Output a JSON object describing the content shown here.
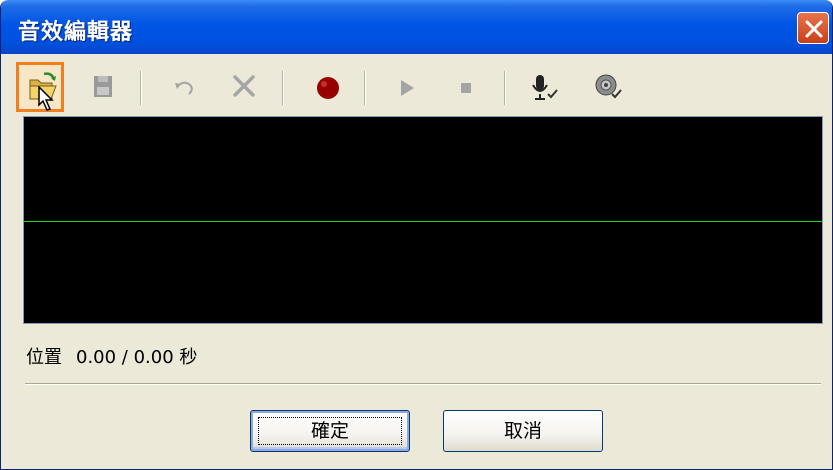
{
  "window": {
    "title": "音效編輯器"
  },
  "toolbar": {
    "buttons": [
      {
        "name": "open-file",
        "icon": "open-folder-icon",
        "active": true
      },
      {
        "name": "save",
        "icon": "save-icon"
      },
      {
        "name": "undo",
        "icon": "undo-icon"
      },
      {
        "name": "delete",
        "icon": "delete-x-icon"
      },
      {
        "name": "record",
        "icon": "record-icon",
        "color": "#990000"
      },
      {
        "name": "play",
        "icon": "play-icon"
      },
      {
        "name": "stop",
        "icon": "stop-icon"
      },
      {
        "name": "microphone",
        "icon": "microphone-icon"
      },
      {
        "name": "speaker-settings",
        "icon": "speaker-icon"
      }
    ]
  },
  "waveform": {
    "background": "#000000",
    "line_color": "#1FD51F"
  },
  "position": {
    "label": "位置",
    "value": "0.00 / 0.00 秒"
  },
  "buttons": {
    "ok_label": "確定",
    "cancel_label": "取消"
  },
  "colors": {
    "titlebar": "#0055E5",
    "highlight": "#F07F21",
    "dialog_bg": "#ECE9D8"
  }
}
